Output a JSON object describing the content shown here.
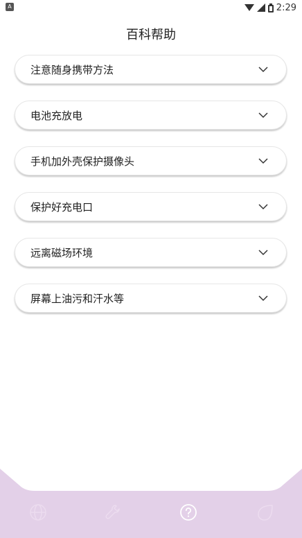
{
  "status_bar": {
    "time": "2:29",
    "left_icon": "A",
    "icons": [
      "wifi-icon",
      "signal-icon",
      "battery-icon"
    ]
  },
  "header": {
    "title": "百科帮助"
  },
  "faq": {
    "items": [
      {
        "label": "注意随身携带方法",
        "icon": "chevron-down-icon"
      },
      {
        "label": "电池充放电",
        "icon": "chevron-down-icon"
      },
      {
        "label": "手机加外壳保护摄像头",
        "icon": "chevron-down-icon"
      },
      {
        "label": "保护好充电口",
        "icon": "chevron-down-icon"
      },
      {
        "label": "远离磁场环境",
        "icon": "chevron-down-icon"
      },
      {
        "label": "屏幕上油污和汗水等",
        "icon": "chevron-down-icon"
      }
    ]
  },
  "bottom_nav": {
    "items": [
      {
        "icon": "globe-icon"
      },
      {
        "icon": "wrench-icon"
      },
      {
        "icon": "help-icon",
        "active": true
      },
      {
        "icon": "leaf-icon"
      }
    ],
    "colors": {
      "background": "#e3d0e8",
      "icon_inactive": "#ecdcef",
      "icon_active": "#ffffff"
    }
  }
}
